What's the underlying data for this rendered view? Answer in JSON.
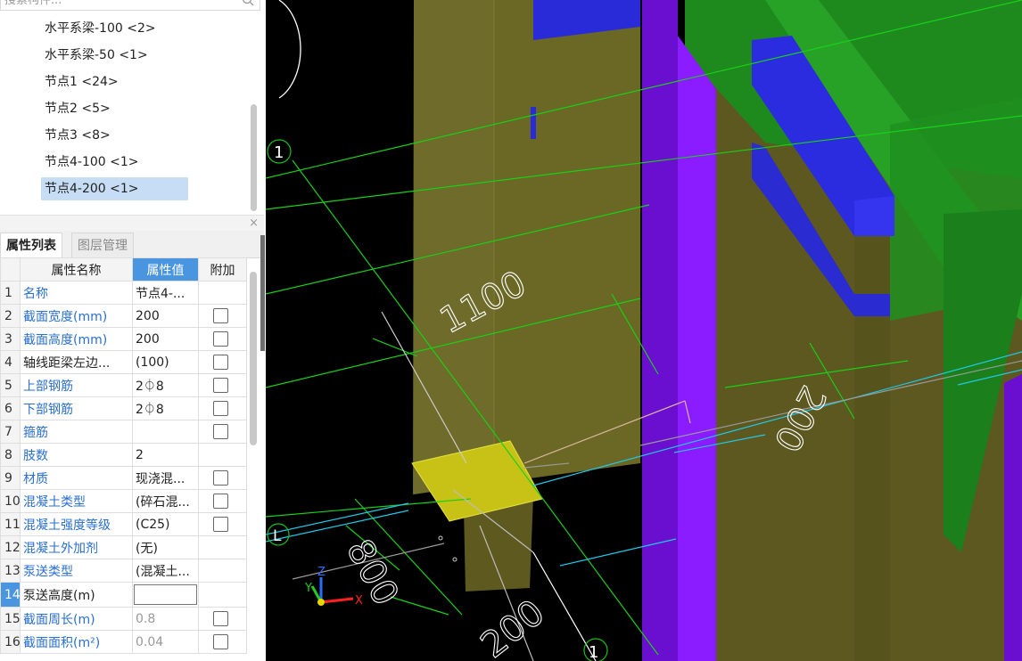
{
  "search": {
    "placeholder": "搜索构件..."
  },
  "tree": {
    "items": [
      {
        "label": "水平系梁-100 <2>"
      },
      {
        "label": "水平系梁-50 <1>"
      },
      {
        "label": "节点1 <24>"
      },
      {
        "label": "节点2 <5>"
      },
      {
        "label": "节点3 <8>"
      },
      {
        "label": "节点4-100 <1>"
      },
      {
        "label": "节点4-200 <1>"
      }
    ],
    "selected_index": 6
  },
  "tabs": {
    "properties": "属性列表",
    "layers": "图层管理"
  },
  "grid": {
    "headers": {
      "name": "属性名称",
      "value": "属性值",
      "extra": "附加"
    },
    "rows": [
      {
        "no": "1",
        "name": "名称",
        "value": "节点4-..."
      },
      {
        "no": "2",
        "name": "截面宽度(mm)",
        "value": "200"
      },
      {
        "no": "3",
        "name": "截面高度(mm)",
        "value": "200"
      },
      {
        "no": "4",
        "name": "轴线距梁左边...",
        "value": "(100)"
      },
      {
        "no": "5",
        "name": "上部钢筋",
        "value": "2⏀8"
      },
      {
        "no": "6",
        "name": "下部钢筋",
        "value": "2⏀8"
      },
      {
        "no": "7",
        "name": "箍筋",
        "value": ""
      },
      {
        "no": "8",
        "name": "肢数",
        "value": "2"
      },
      {
        "no": "9",
        "name": "材质",
        "value": "现浇混..."
      },
      {
        "no": "10",
        "name": "混凝土类型",
        "value": "(碎石混..."
      },
      {
        "no": "11",
        "name": "混凝土强度等级",
        "value": "(C25)"
      },
      {
        "no": "12",
        "name": "混凝土外加剂",
        "value": "(无)"
      },
      {
        "no": "13",
        "name": "泵送类型",
        "value": "(混凝土..."
      },
      {
        "no": "14",
        "name": "泵送高度(m)",
        "value": ""
      },
      {
        "no": "15",
        "name": "截面周长(m)",
        "value": "0.8"
      },
      {
        "no": "16",
        "name": "截面面积(m²)",
        "value": "0.04"
      }
    ]
  },
  "viewport": {
    "dimensions": {
      "d1100": "1100",
      "d200a": "200",
      "d800": "800",
      "d200b": "200"
    },
    "axis_labels": {
      "a1_top": "1",
      "a1_bottom": "1",
      "aL": "L"
    },
    "gizmo": {
      "x": "X",
      "y": "Y",
      "z": "Z"
    }
  },
  "colors": {
    "accent": "#4a95e0",
    "selected_row": "#c6ddf5",
    "viewport_bg": "#000000"
  }
}
